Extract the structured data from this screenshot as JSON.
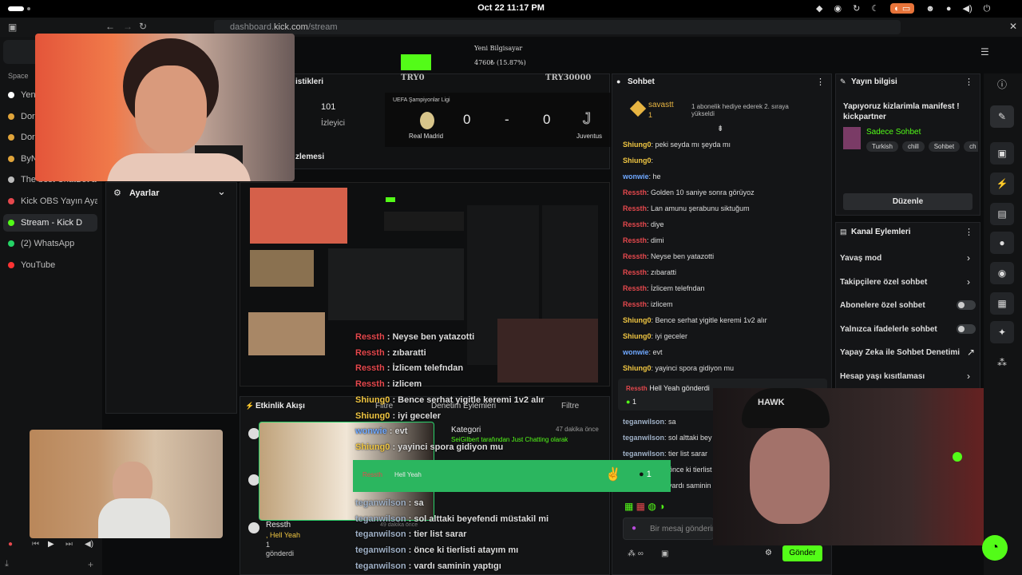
{
  "clock": "Oct 22  11:17 PM",
  "url": {
    "prefix": "dashboard.",
    "host": "kick.com",
    "path": "/stream"
  },
  "sidebar": {
    "section": "Space",
    "items": [
      {
        "label": "Yeni",
        "color": "#ffffff"
      },
      {
        "label": "Dor",
        "color": "#e0a43a"
      },
      {
        "label": "Dor",
        "color": "#e0a43a"
      },
      {
        "label": "ByN",
        "color": "#e0a43a"
      },
      {
        "label": "The best ChatBot a",
        "color": "#bbbbbb"
      },
      {
        "label": "Kick OBS Yayın Aya",
        "color": "#e5484d"
      },
      {
        "label": "Stream - Kick D",
        "color": "#53fc18"
      },
      {
        "label": "(2) WhatsApp",
        "color": "#25d366"
      },
      {
        "label": "YouTube",
        "color": "#ff3333"
      }
    ]
  },
  "goal": {
    "title": "Yeni Bilgisayar",
    "amount": "4760₺ (15.87%)",
    "min": "TRY0",
    "max": "TRY30000",
    "progress": 0.1587
  },
  "stats": {
    "title_frag": "istikleri",
    "viewers": "101",
    "viewers_label": "İzleyici",
    "preview_frag": "zlemesi"
  },
  "scoreboard": {
    "league": "UEFA Şampiyonlar Ligi",
    "home": "Real Madrid",
    "away": "Juventus",
    "home_score": "0",
    "away_score": "0",
    "sep": "-"
  },
  "settings_label": "Ayarlar",
  "events": {
    "title": "Etkinlik Akışı",
    "filter": "Filtre",
    "mod_title": "Denetim Eylemleri",
    "mod_filter": "Filtre",
    "category_label": "Kategori",
    "category_time": "47 dakika önce",
    "category_text": "SeiGilbert tarafından Just Chatting olarak",
    "sub_user": "Ressth",
    "sub_msg": ", Hell Yeah",
    "sub_count": "1",
    "sub_sent": "gönderdi",
    "small_time": "49 dakika önce"
  },
  "chat": {
    "title": "Sohbet",
    "pinned_user": "savastt",
    "pinned_count": "1",
    "pinned_msg": "1 abonelik hediye ederek 2. sıraya yükseldi",
    "lines": [
      {
        "user": "Shiung0",
        "cls": "un-yel",
        "msg": "peki seyda mı şeyda mı"
      },
      {
        "user": "Shiung0",
        "cls": "un-yel",
        "msg": ""
      },
      {
        "user": "wonwie",
        "cls": "un-blu",
        "msg": "he"
      },
      {
        "user": "Ressth",
        "cls": "un-red",
        "msg": "Golden 10 saniye sonra görüyoz"
      },
      {
        "user": "Ressth",
        "cls": "un-red",
        "msg": "Lan amunu şerabunu siktuğum"
      },
      {
        "user": "Ressth",
        "cls": "un-red",
        "msg": "diye"
      },
      {
        "user": "Ressth",
        "cls": "un-red",
        "msg": "dimi"
      },
      {
        "user": "Ressth",
        "cls": "un-red",
        "msg": "Neyse ben yatazotti"
      },
      {
        "user": "Ressth",
        "cls": "un-red",
        "msg": "zıbaratti"
      },
      {
        "user": "Ressth",
        "cls": "un-red",
        "msg": "İzlicem telefndan"
      },
      {
        "user": "Ressth",
        "cls": "un-red",
        "msg": "izlicem"
      },
      {
        "user": "Shiung0",
        "cls": "un-yel",
        "msg": "Bence serhat yigitle keremi 1v2 alır"
      },
      {
        "user": "Shiung0",
        "cls": "un-yel",
        "msg": "iyi geceler"
      },
      {
        "user": "wonwie",
        "cls": "un-blu",
        "msg": "evt"
      },
      {
        "user": "Shiung0",
        "cls": "un-yel",
        "msg": "yayinci spora gidiyon mu"
      }
    ],
    "hl_user": "Ressth",
    "hl_msg": "Hell Yeah",
    "hl_sent": "gönderdi",
    "hl_count": "1",
    "lines2": [
      {
        "user": "teganwilson",
        "msg": "sa"
      },
      {
        "user": "teganwilson",
        "msg": "sol alttaki bey"
      },
      {
        "user": "teganwilson",
        "msg": "tier list sarar"
      },
      {
        "user": "teganwilson",
        "msg": "önce ki tierlist"
      },
      {
        "user": "teganwilson",
        "msg": "vardı saminin"
      }
    ],
    "placeholder": "Bir mesaj gönderin",
    "send": "Gönder"
  },
  "overlay": {
    "lines": [
      {
        "user": "Ressth",
        "cls": "un-red",
        "msg": "Neyse ben yatazotti"
      },
      {
        "user": "Ressth",
        "cls": "un-red",
        "msg": "zıbaratti"
      },
      {
        "user": "Ressth",
        "cls": "un-red",
        "msg": "İzlicem telefndan"
      },
      {
        "user": "Ressth",
        "cls": "un-red",
        "msg": "izlicem"
      },
      {
        "user": "Shiung0",
        "cls": "un-yel",
        "msg": "Bence serhat yigitle keremi 1v2 alır"
      },
      {
        "user": "Shiung0",
        "cls": "un-yel",
        "msg": "iyi geceler"
      },
      {
        "user": "wonwie",
        "cls": "un-blu",
        "msg": "evt"
      },
      {
        "user": "Shiung0",
        "cls": "un-yel",
        "msg": "yayinci spora gidiyon mu"
      }
    ],
    "hl_user": "Ressth",
    "hl_msg": "Hell Yeah",
    "hl_count": "1",
    "lines2": [
      {
        "user": "teganwilson",
        "msg": "sa"
      },
      {
        "user": "teganwilson",
        "msg": "sol alttaki beyefendi müstakil mi"
      },
      {
        "user": "teganwilson",
        "msg": "tier list sarar"
      },
      {
        "user": "teganwilson",
        "msg": "önce ki tierlisti atayım mı"
      },
      {
        "user": "teganwilson",
        "msg": "vardı saminin yaptıgı"
      }
    ]
  },
  "stream_info": {
    "title": "Yayın bilgisi",
    "stream_title": "Yapıyoruz kizlarimla manifest ! kickpartner",
    "category": "Sadece Sohbet",
    "tags": [
      "Turkish",
      "chill",
      "Sohbet",
      "ch"
    ],
    "edit": "Düzenle"
  },
  "channel_actions": {
    "title": "Kanal Eylemleri",
    "items": [
      {
        "label": "Yavaş mod",
        "kind": "arrow"
      },
      {
        "label": "Takipçilere özel sohbet",
        "kind": "arrow"
      },
      {
        "label": "Abonelere özel sohbet",
        "kind": "toggle"
      },
      {
        "label": "Yalnızca ifadelerle sohbet",
        "kind": "toggle"
      },
      {
        "label": "Yapay Zeka ile Sohbet Denetimi",
        "kind": "ext"
      },
      {
        "label": "Hesap yaşı kısıtlaması",
        "kind": "arrow"
      }
    ]
  }
}
